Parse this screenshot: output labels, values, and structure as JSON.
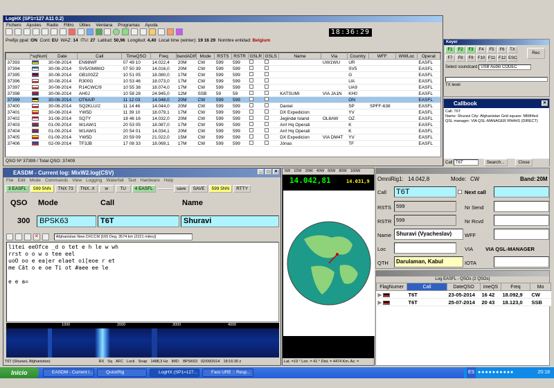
{
  "main_window": {
    "title": "LogHX (SP1=127 A11 0.2)",
    "menu": [
      "Fichero",
      "Ajustes",
      "Radio",
      "Filtro",
      "Útiles",
      "Ventana",
      "Programas",
      "Ayuda"
    ],
    "clock": "18:36:29",
    "info_bar": {
      "prefix_label": "Prefijo ppal:",
      "prefix": "ON",
      "cont_label": "Cont:",
      "cont": "EU",
      "waz_label": "WAZ:",
      "waz": "14",
      "itu_label": "ITU:",
      "itu": "27",
      "lat_label": "Latitud:",
      "lat": "50,96",
      "lon_label": "Longitud:",
      "lon": "4,40",
      "localtime_label": "Local time (winter):",
      "localtime": "19 16 29",
      "entity_label": "Nombre entidad:",
      "entity": "Belgium"
    },
    "columns": [
      "",
      "*sqNum",
      "Date",
      "Call",
      "TimeQSO",
      "Freq",
      "bandADIF",
      "Mode",
      "RSTS",
      "RSTR",
      "GSLR",
      "GSLS",
      "Name",
      "Via",
      "Country",
      "WFF",
      "WWLoc",
      "Operat"
    ],
    "rows": [
      {
        "num": "37393",
        "date": "30-08-2014",
        "call": "EN98WF",
        "time": "07 49 10",
        "freq": "14.022,4",
        "band": "20M",
        "mode": "CW",
        "rsts": "599",
        "rstr": "599",
        "name": "",
        "via": "UW1WU",
        "country": "UR",
        "wff": "",
        "op": "EASFL",
        "flag": "ua"
      },
      {
        "num": "37394",
        "date": "30-08-2014",
        "call": "SV5/GM8IIO",
        "time": "07 50 39",
        "freq": "14.016,0",
        "band": "20M",
        "mode": "CW",
        "rsts": "599",
        "rstr": "599",
        "name": "",
        "via": "",
        "country": "SV5",
        "wff": "",
        "op": "EASFL",
        "flag": "gr"
      },
      {
        "num": "37395",
        "date": "30-08-2014",
        "call": "GB100ZZ",
        "time": "10 51 05",
        "freq": "18.080,0",
        "band": "17M",
        "mode": "CW",
        "rsts": "599",
        "rstr": "599",
        "name": "",
        "via": "",
        "country": "G",
        "wff": "",
        "op": "EASFL",
        "flag": "gb"
      },
      {
        "num": "37396",
        "date": "30-08-2014",
        "call": "R300G",
        "time": "10 53 46",
        "freq": "18.073,0",
        "band": "17M",
        "mode": "CW",
        "rsts": "599",
        "rstr": "599",
        "name": "",
        "via": "",
        "country": "UA",
        "wff": "",
        "op": "EASFL",
        "flag": "ru"
      },
      {
        "num": "37397",
        "date": "30-08-2014",
        "call": "R14CWC/9",
        "time": "10 55 38",
        "freq": "18.074,0",
        "band": "17M",
        "mode": "CW",
        "rsts": "599",
        "rstr": "599",
        "name": "",
        "via": "",
        "country": "UA9",
        "wff": "",
        "op": "EASFL",
        "flag": "ru"
      },
      {
        "num": "37398",
        "date": "30-08-2014",
        "call": "AH0J",
        "time": "10 58 28",
        "freq": "24.945,0",
        "band": "12M",
        "mode": "SSB",
        "rsts": "59",
        "rstr": "59",
        "name": "KATSUMI",
        "via": "VIA JA1N",
        "country": "KH0",
        "wff": "",
        "op": "EASFL",
        "flag": "us"
      },
      {
        "num": "37399",
        "date": "30-08-2014",
        "call": "OT6A/P",
        "time": "11 12 03",
        "freq": "14.048,0",
        "band": "20M",
        "mode": "CW",
        "rsts": "599",
        "rstr": "599",
        "name": "",
        "via": "",
        "country": "ON",
        "wff": "",
        "op": "EASFL",
        "flag": "be",
        "selected": true
      },
      {
        "num": "37400",
        "date": "30-08-2014",
        "call": "SQ2KLU/2",
        "time": "11 14 46",
        "freq": "14.044,0",
        "band": "20M",
        "mode": "CW",
        "rsts": "599",
        "rstr": "599",
        "name": "Daniel",
        "via": "",
        "country": "SP",
        "wff": "SPFF-638",
        "op": "EASFL",
        "flag": "pl"
      },
      {
        "num": "37401",
        "date": "30-08-2014",
        "call": "YW5D",
        "time": "11 39 10",
        "freq": "18.079,1",
        "band": "17M",
        "mode": "CW",
        "rsts": "599",
        "rstr": "599",
        "name": "DX Expedicion",
        "via": "",
        "country": "YV",
        "wff": "",
        "op": "EASFL",
        "flag": "ve"
      },
      {
        "num": "37402",
        "date": "31-08-2014",
        "call": "SQ7Y",
        "time": "18 46 16",
        "freq": "14.032,0",
        "band": "20M",
        "mode": "CW",
        "rsts": "599",
        "rstr": "599",
        "name": "Jegindø Island",
        "via": "OL8AW",
        "country": "OZ",
        "wff": "",
        "op": "EASFL",
        "flag": "dk"
      },
      {
        "num": "37403",
        "date": "01-09-2014",
        "call": "W1AW/1",
        "time": "20 53 05",
        "freq": "18.087,0",
        "band": "17M",
        "mode": "CW",
        "rsts": "599",
        "rstr": "599",
        "name": "Arrl Hq Operati",
        "via": "",
        "country": "K",
        "wff": "",
        "op": "EASFL",
        "flag": "us"
      },
      {
        "num": "37404",
        "date": "01-09-2014",
        "call": "W1AW/1",
        "time": "20 54 01",
        "freq": "14.034,1",
        "band": "20M",
        "mode": "CW",
        "rsts": "599",
        "rstr": "599",
        "name": "Arrl Hq Operati",
        "via": "",
        "country": "K",
        "wff": "",
        "op": "EASFL",
        "flag": "us"
      },
      {
        "num": "37405",
        "date": "01-09-2014",
        "call": "YW5D",
        "time": "20 59 09",
        "freq": "21.022,0",
        "band": "15M",
        "mode": "CW",
        "rsts": "599",
        "rstr": "599",
        "name": "DX Expedicion",
        "via": "VIA DM4T",
        "country": "YV",
        "wff": "",
        "op": "EASFL",
        "flag": "ve"
      },
      {
        "num": "37406",
        "date": "02-09-2014",
        "call": "TF3JB",
        "time": "17 08 33",
        "freq": "18.069,1",
        "band": "17M",
        "mode": "CW",
        "rsts": "599",
        "rstr": "599",
        "name": "Jónas",
        "via": "",
        "country": "TF",
        "wff": "",
        "op": "EASFL",
        "flag": "is"
      }
    ],
    "status": "QSO Nº 37399 / Total QSO: 37409"
  },
  "right_panel": {
    "title": "Keyer",
    "fkeys_row1": [
      "F1",
      "F2",
      "F3",
      "F4",
      "F5",
      "F6",
      "TX"
    ],
    "fkeys_row2": [
      "F7",
      "F8",
      "F9",
      "F10",
      "F11",
      "F12",
      "ESC"
    ],
    "rec_label": "Rec",
    "soundcard_label": "Select soundcard",
    "soundcard_value": "USB Audio CODEC",
    "tx_level_label": "TX level"
  },
  "callbook": {
    "title": "Callbook",
    "lines": [
      "Call: T6T",
      "Name: Shuravi  City: Afghanistan  Grid square: MM44ed",
      "QSL manager: VIA QSL-MANAGER RN4HS (DIRECT)"
    ],
    "call_label": "Call",
    "call_value": "T6T",
    "search_label": "Search...",
    "close_label": "Close"
  },
  "easdm": {
    "title": "EASDM - Current log: MixW2.log(CSV)",
    "menu": [
      "File",
      "Edit",
      "Mode",
      "Commands",
      "View",
      "Logging",
      "Waterfall",
      "Text",
      "Hardware",
      "Help"
    ],
    "buttons": [
      "3 EASFL",
      "599 5NN",
      "TNX 73",
      "TNX..X",
      "w",
      "TU",
      "4 EASFL",
      "",
      "save",
      "SAVE",
      "599 5NN",
      "RTTY"
    ],
    "col_qso": "QSO",
    "col_mode": "Mode",
    "col_call": "Call",
    "col_name": "Name",
    "qso": "300",
    "mode": "BPSK63",
    "call": "T6T",
    "name": "Shuravi",
    "dropdown": "Afghanistan  New DXCCM [165 Deg, 3574 km (2221 miles)]",
    "rx_text": [
      "litei eeOfce     _d o tet e h   le w wh",
      "rrst o o w o tee   eel",
      "uoO  oo e ea|er elaet oi[eoe  r et",
      "me  Cãt o e  oe Ti   ot #aee   ee le",
      "",
      "e e    a="
    ],
    "ruler": [
      "1000",
      "2000",
      "3000",
      "4000"
    ],
    "status": [
      "T6T (Shurani, Afghanistan)",
      "RX",
      "Sq",
      "AFC",
      "Lock",
      "Snap",
      "1488,3 Hz",
      "IMD:",
      "BPSK63",
      "02/09/2014",
      "18:16:30 z"
    ]
  },
  "band_map": {
    "bands": [
      "5W",
      "10W",
      "20W",
      "40W",
      "60W",
      "80W",
      "160W"
    ],
    "freq": "14.042,81",
    "freq2": "14.031,9",
    "map_status": "Lat. =19 ° Lon. = 41 ° Dist. = 4474 Km. Az. ="
  },
  "qso_panel": {
    "title": "",
    "rig": "OmniRig1:",
    "rig_freq": "14.042,8",
    "mode_label": "Mode:",
    "mode": "CW",
    "band_label": "Band:",
    "band": "20M",
    "call_label": "Call",
    "call": "T6T",
    "next_call_label": "Next call",
    "rsts_label": "RSTS",
    "rsts": "599",
    "nrsend_label": "Nr Send",
    "rstr_label": "RSTR",
    "rstr": "599",
    "nrrcvd_label": "Nr Rcvd",
    "name_label": "Name",
    "name": "Shuravi (Vyacheslav)",
    "wff_label": "WFF",
    "loc_label": "Loc",
    "via_label": "VIA",
    "via": "VIA QSL-MANAGER",
    "qth_label": "QTH",
    "qth": "Darulaman, Kabul",
    "iota_label": "IOTA"
  },
  "previous": {
    "title": "Log EASFL - QSOs (2 QSOs)",
    "columns": [
      "FlagNumer",
      "Call",
      "DateQSO",
      "imeQS",
      "Freq",
      "Mo"
    ],
    "rows": [
      {
        "call": "T6T",
        "date": "23-05-2014",
        "time": "16 42",
        "freq": "18.092,9",
        "mode": "CW"
      },
      {
        "call": "T6T",
        "date": "25-07-2014",
        "time": "20 43",
        "freq": "18.123,0",
        "mode": "SSB"
      }
    ]
  },
  "taskbar": {
    "start": "Inicio",
    "tasks": [
      "EASDM - Current l...",
      "QuickRig",
      "LogHX (SP1=127...",
      "Faro URE :: Resp..."
    ],
    "lang": "ES",
    "time": "20:18"
  }
}
